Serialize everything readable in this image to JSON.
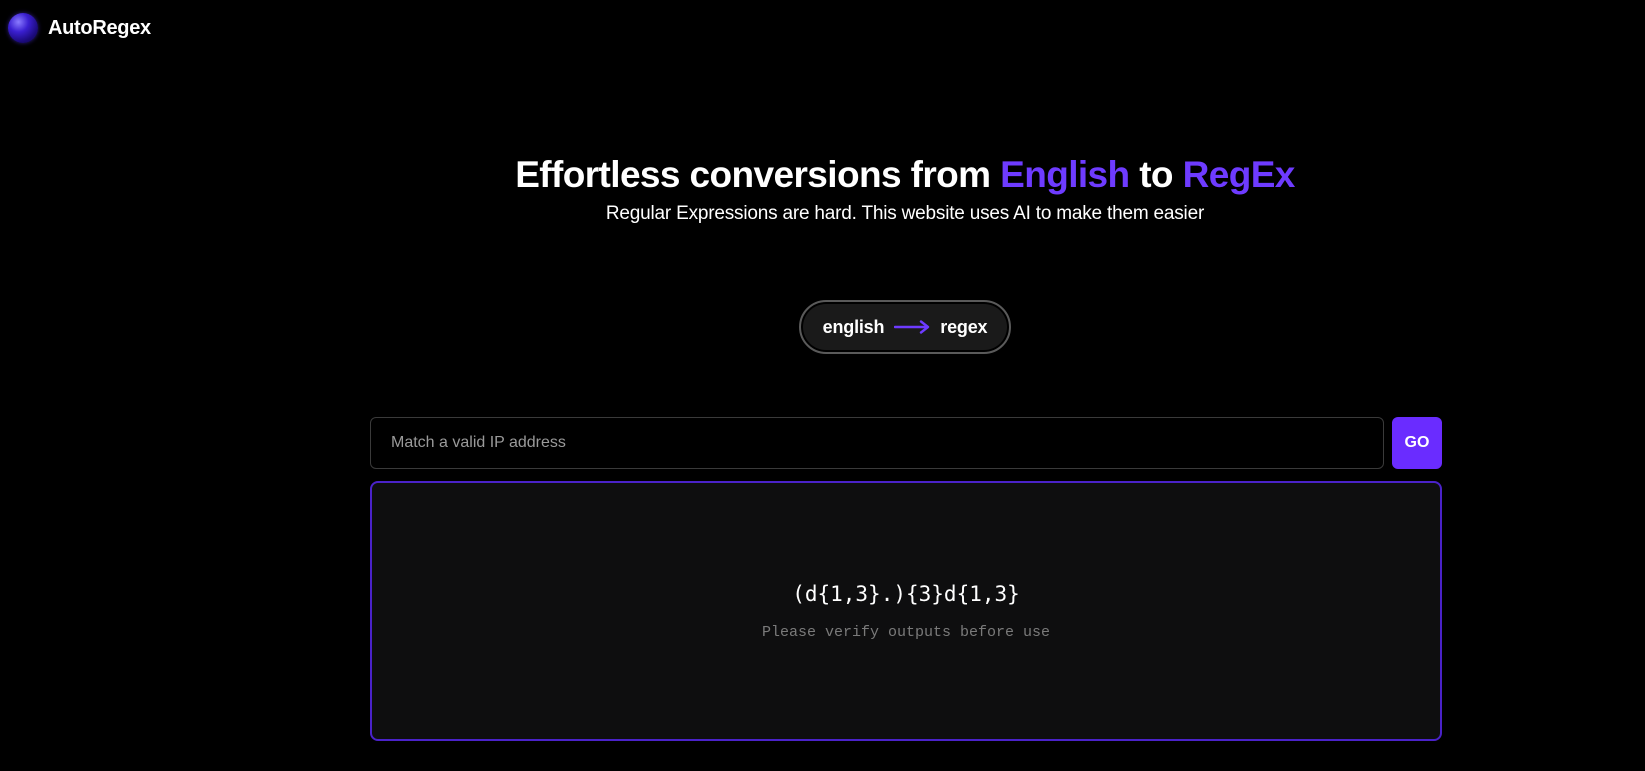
{
  "brand": {
    "name": "AutoRegex"
  },
  "hero": {
    "title_prefix": "Effortless conversions from ",
    "title_accent_1": "English",
    "title_middle": " to ",
    "title_accent_2": "RegEx",
    "subtitle": "Regular Expressions are hard. This website uses AI to make them easier"
  },
  "mode_toggle": {
    "from_label": "english",
    "to_label": "regex"
  },
  "prompt": {
    "value": "",
    "placeholder": "Match a valid IP address",
    "go_label": "GO"
  },
  "output": {
    "regex": "(d{1,3}.){3}d{1,3}",
    "note": "Please verify outputs before use"
  },
  "colors": {
    "background": "#000000",
    "accent": "#6e3bff",
    "go_button": "#6a2cff",
    "panel_border": "#4a22c9"
  }
}
